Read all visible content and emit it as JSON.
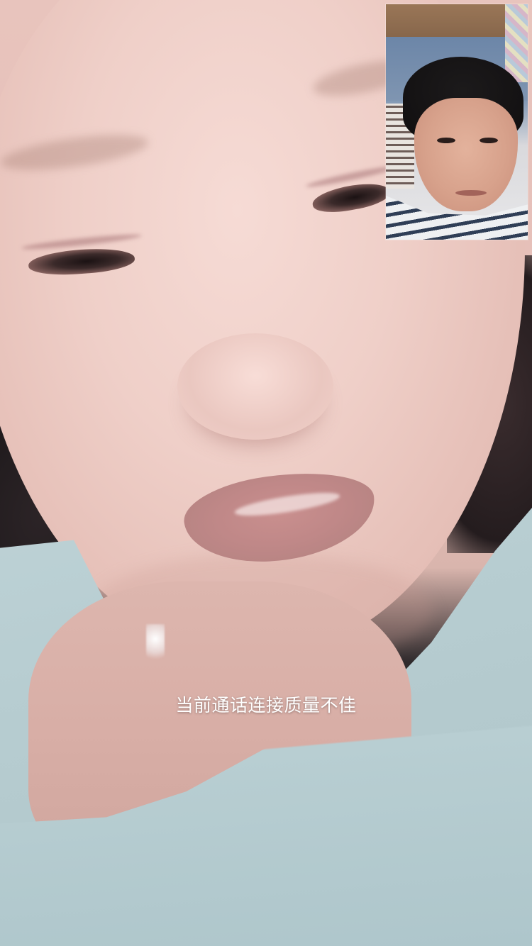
{
  "call": {
    "status_message": "当前通话连接质量不佳"
  },
  "remote_video": {
    "description_icon": "remote-participant-video"
  },
  "self_preview": {
    "description_icon": "local-camera-preview"
  },
  "colors": {
    "status_text": "#ffffff",
    "preview_border": "#ffffff"
  }
}
